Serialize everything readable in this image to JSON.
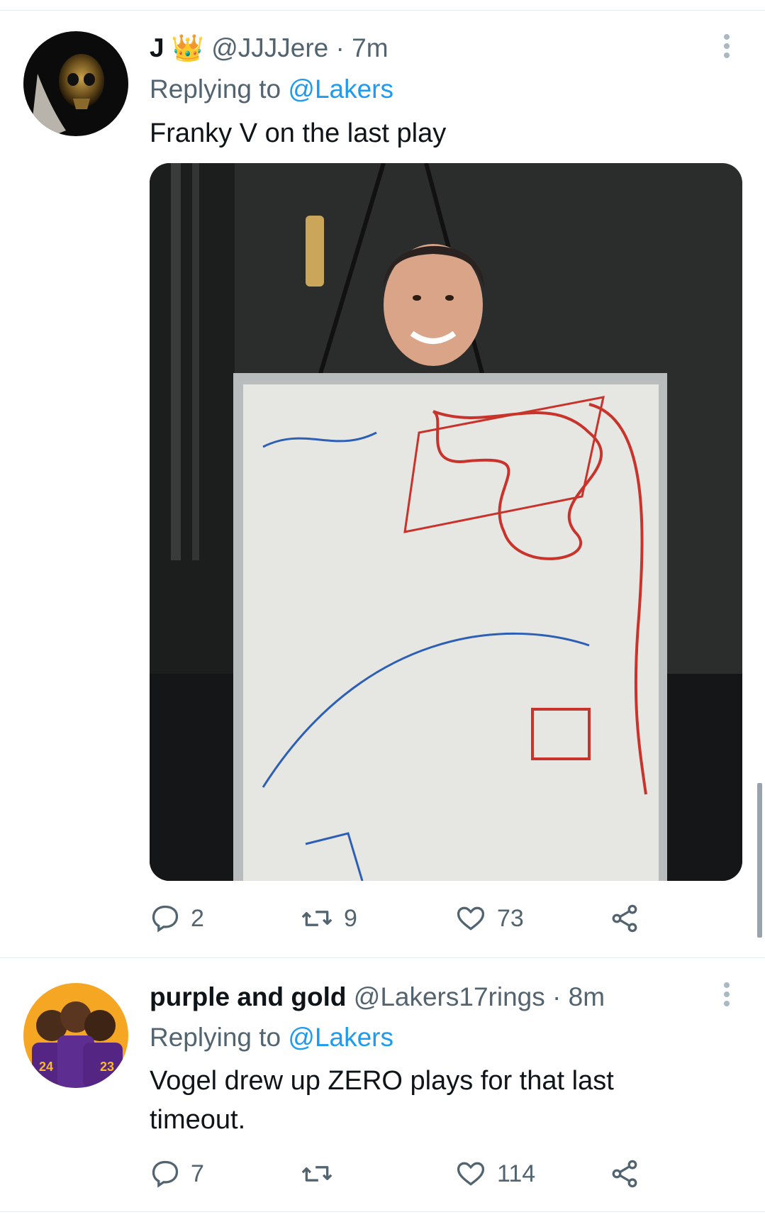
{
  "tweets": [
    {
      "name": "J",
      "name_emoji": "👑",
      "handle": "@JJJJere",
      "time": "7m",
      "replying_prefix": "Replying to",
      "replying_to": "@Lakers",
      "text": "Franky V on the last play",
      "avatar_icon": "golden-skull-avatar",
      "media_description_icon": "whiteboard-photo",
      "reply_count": "2",
      "retweet_count": "9",
      "like_count": "73"
    },
    {
      "name": "purple and gold",
      "handle": "@Lakers17rings",
      "time": "8m",
      "replying_prefix": "Replying to",
      "replying_to": "@Lakers",
      "text": "Vogel drew up ZERO plays for that last timeout.",
      "avatar_icon": "lakers-players-avatar",
      "reply_count": "7",
      "retweet_count": "",
      "like_count": "114"
    }
  ],
  "colors": {
    "text": "#0f1419",
    "secondary": "#536471",
    "link": "#1d9bf0",
    "divider": "#e6ecf0"
  },
  "icons": [
    "reply-icon",
    "retweet-icon",
    "like-icon",
    "share-icon",
    "more-options-icon"
  ]
}
